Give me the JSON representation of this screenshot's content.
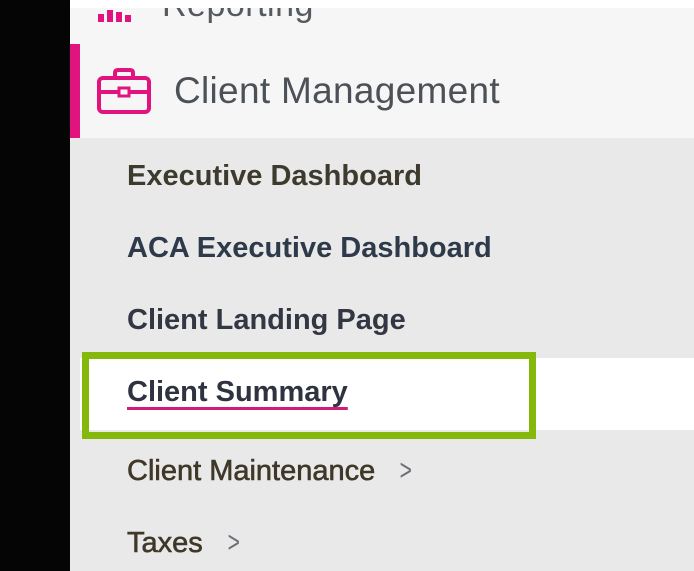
{
  "nav": {
    "reporting": {
      "label": "Reporting",
      "icon": "bar-chart-icon"
    },
    "client_management": {
      "label": "Client Management",
      "icon": "briefcase-icon",
      "accent_color": "#e0137f"
    },
    "submenu": {
      "executive_dashboard": "Executive Dashboard",
      "aca_executive_dashboard": "ACA Executive Dashboard",
      "client_landing_page": "Client Landing Page",
      "client_summary": "Client Summary",
      "client_maintenance": "Client Maintenance",
      "taxes": "Taxes",
      "chevron": ">"
    },
    "selected_item": "Client Summary",
    "highlight_color": "#84b80b"
  }
}
